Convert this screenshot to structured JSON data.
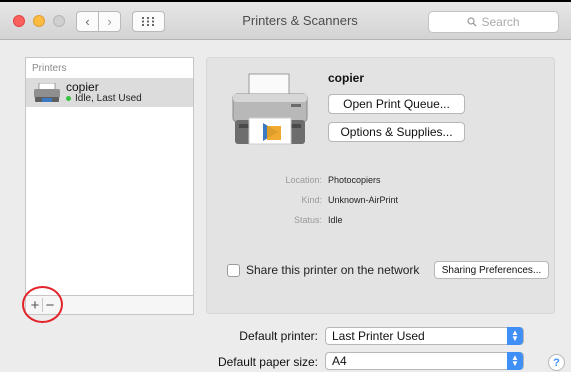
{
  "window": {
    "title": "Printers & Scanners",
    "search_placeholder": "Search"
  },
  "sidebar": {
    "header": "Printers",
    "printers": [
      {
        "name": "copier",
        "status": "Idle, Last Used"
      }
    ],
    "add_label": "+",
    "remove_label": "−"
  },
  "detail": {
    "name": "copier",
    "open_queue_label": "Open Print Queue...",
    "options_label": "Options & Supplies...",
    "location_key": "Location:",
    "location_value": "Photocopiers",
    "kind_key": "Kind:",
    "kind_value": "Unknown-AirPrint",
    "status_key": "Status:",
    "status_value": "Idle",
    "share_label": "Share this printer on the network",
    "sharing_prefs_label": "Sharing Preferences..."
  },
  "defaults": {
    "printer_label": "Default printer:",
    "printer_value": "Last Printer Used",
    "paper_label": "Default paper size:",
    "paper_value": "A4"
  },
  "help_label": "?",
  "colors": {
    "accent": "#3f8ff7",
    "highlight_circle": "#e3242b",
    "status_dot": "#39c23f"
  }
}
